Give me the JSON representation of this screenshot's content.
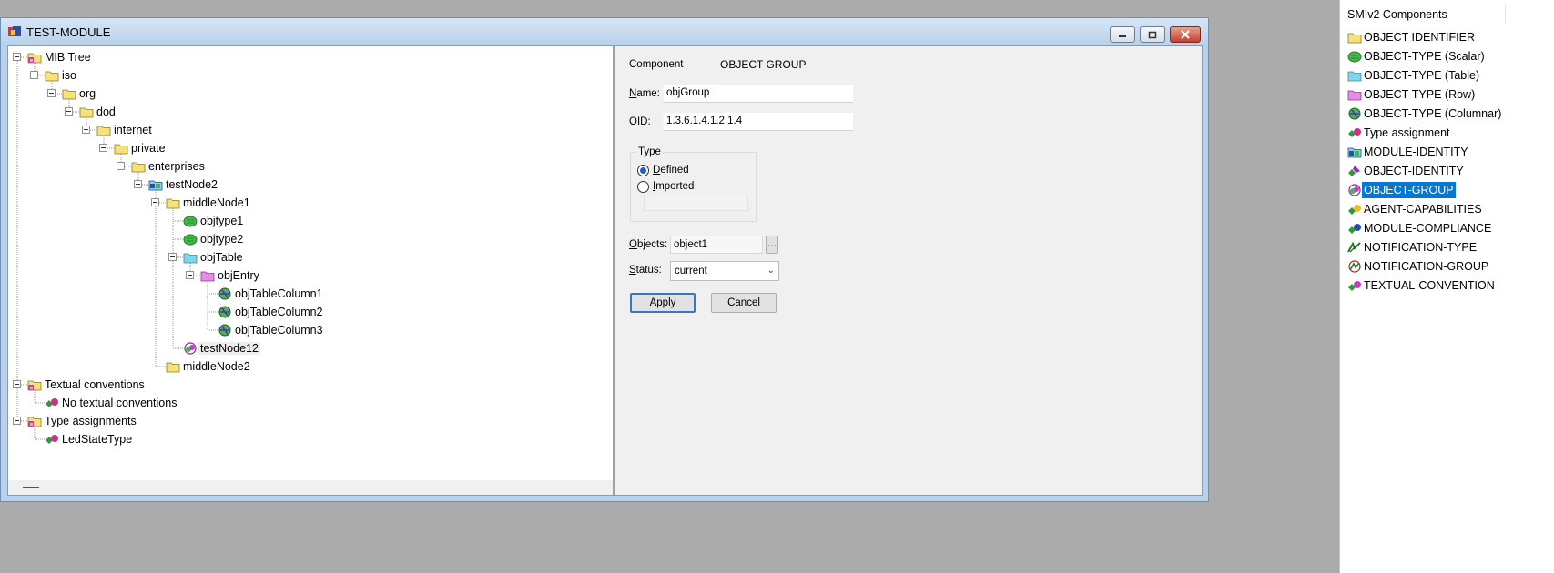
{
  "window": {
    "title": "TEST-MODULE",
    "buttons": {
      "minimize": "minimize",
      "maximize": "maximize",
      "close": "close"
    }
  },
  "tree": {
    "nodes": [
      {
        "label": "MIB Tree",
        "icon": "module-folder-icon",
        "depth": 0,
        "toggle": true
      },
      {
        "label": "iso",
        "icon": "folder-icon",
        "depth": 1,
        "toggle": true
      },
      {
        "label": "org",
        "icon": "folder-icon",
        "depth": 2,
        "toggle": true
      },
      {
        "label": "dod",
        "icon": "folder-icon",
        "depth": 3,
        "toggle": true
      },
      {
        "label": "internet",
        "icon": "folder-icon",
        "depth": 4,
        "toggle": true
      },
      {
        "label": "private",
        "icon": "folder-icon",
        "depth": 5,
        "toggle": true
      },
      {
        "label": "enterprises",
        "icon": "folder-icon",
        "depth": 6,
        "toggle": true
      },
      {
        "label": "testNode2",
        "icon": "module-identity-icon",
        "depth": 7,
        "toggle": true
      },
      {
        "label": "middleNode1",
        "icon": "folder-icon",
        "depth": 8,
        "toggle": true
      },
      {
        "label": "objtype1",
        "icon": "scalar-icon",
        "depth": 9,
        "toggle": false
      },
      {
        "label": "objtype2",
        "icon": "scalar-icon",
        "depth": 9,
        "toggle": false
      },
      {
        "label": "objTable",
        "icon": "table-folder-icon",
        "depth": 9,
        "toggle": true
      },
      {
        "label": "objEntry",
        "icon": "row-folder-icon",
        "depth": 10,
        "toggle": true
      },
      {
        "label": "objTableColumn1",
        "icon": "columnar-icon",
        "depth": 11,
        "toggle": false
      },
      {
        "label": "objTableColumn2",
        "icon": "columnar-icon",
        "depth": 11,
        "toggle": false
      },
      {
        "label": "objTableColumn3",
        "icon": "columnar-icon",
        "depth": 11,
        "toggle": false
      },
      {
        "label": "testNode12",
        "icon": "object-group-icon",
        "depth": 9,
        "toggle": false,
        "hover": true
      },
      {
        "label": "middleNode2",
        "icon": "folder-icon",
        "depth": 8,
        "toggle": false
      },
      {
        "label": "Textual conventions",
        "icon": "module-folder-icon",
        "depth": 0,
        "toggle": true
      },
      {
        "label": "No textual conventions",
        "icon": "type-assignment-icon",
        "depth": 1,
        "toggle": false
      },
      {
        "label": "Type assignments",
        "icon": "module-folder-icon",
        "depth": 0,
        "toggle": true
      },
      {
        "label": "LedStateType",
        "icon": "type-assignment-icon",
        "depth": 1,
        "toggle": false
      }
    ]
  },
  "form": {
    "component_label": "Component",
    "component_value": "OBJECT GROUP",
    "name_label": "Name:",
    "name_value": "objGroup",
    "oid_label": "OID:",
    "oid_value": "1.3.6.1.4.1.2.1.4",
    "type_legend": "Type",
    "type_defined": "Defined",
    "type_imported": "Imported",
    "type_selected": "Defined",
    "objects_label": "Objects:",
    "objects_value": "object1",
    "browse_label": "...",
    "status_label": "Status:",
    "status_value": "current",
    "apply_label": "Apply",
    "cancel_label": "Cancel"
  },
  "components": {
    "header": "SMIv2 Components",
    "selected": "OBJECT-GROUP",
    "items": [
      {
        "label": "OBJECT IDENTIFIER",
        "icon": "folder-icon"
      },
      {
        "label": "OBJECT-TYPE (Scalar)",
        "icon": "scalar-icon"
      },
      {
        "label": "OBJECT-TYPE (Table)",
        "icon": "table-folder-icon"
      },
      {
        "label": "OBJECT-TYPE (Row)",
        "icon": "row-folder-icon"
      },
      {
        "label": "OBJECT-TYPE (Columnar)",
        "icon": "columnar-icon"
      },
      {
        "label": "Type assignment",
        "icon": "type-assignment-icon"
      },
      {
        "label": "MODULE-IDENTITY",
        "icon": "module-identity-icon"
      },
      {
        "label": "OBJECT-IDENTITY",
        "icon": "object-identity-icon"
      },
      {
        "label": "OBJECT-GROUP",
        "icon": "object-group-icon"
      },
      {
        "label": "AGENT-CAPABILITIES",
        "icon": "agent-capabilities-icon"
      },
      {
        "label": "MODULE-COMPLIANCE",
        "icon": "module-compliance-icon"
      },
      {
        "label": "NOTIFICATION-TYPE",
        "icon": "notification-type-icon"
      },
      {
        "label": "NOTIFICATION-GROUP",
        "icon": "notification-group-icon"
      },
      {
        "label": "TEXTUAL-CONVENTION",
        "icon": "textual-convention-icon"
      }
    ]
  },
  "colors": {
    "desktop": "#ababab",
    "titlebar": "#b9d1ea",
    "selection": "#0078d7",
    "folder": "#f6e27a",
    "table": "#7fd6e8",
    "row": "#e58be8",
    "scalar": "#46b84a"
  }
}
